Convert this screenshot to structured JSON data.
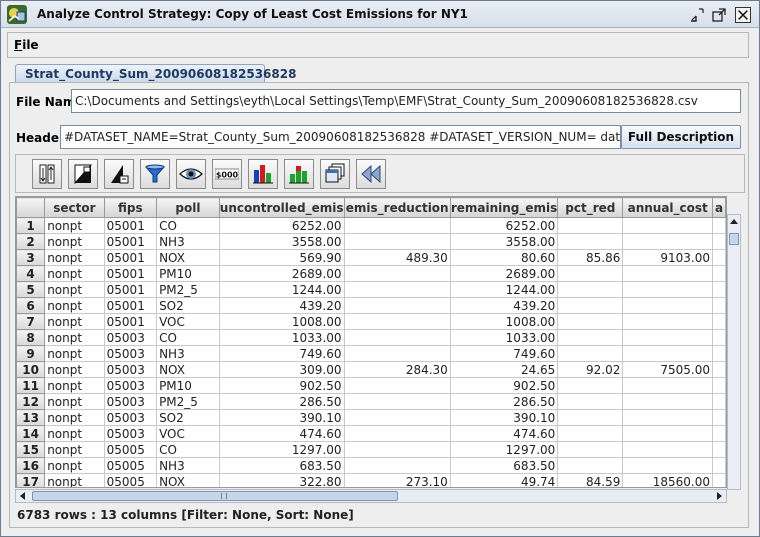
{
  "window": {
    "title": "Analyze Control Strategy: Copy of Least Cost Emissions for NY1"
  },
  "menu": {
    "file_label_u": "F",
    "file_label_rest": "ile"
  },
  "tab": {
    "label": "Strat_County_Sum_20090608182536828"
  },
  "form": {
    "file_name_label": "File Name",
    "file_name_value": "C:\\Documents and Settings\\eyth\\Local Settings\\Temp\\EMF\\Strat_County_Sum_20090608182536828.csv",
    "header_label": "Header",
    "header_value": "#DATASET_NAME=Strat_County_Sum_20090608182536828 #DATASET_VERSION_NUM= dataset.ge",
    "full_description_label": "Full Description"
  },
  "toolbar": {
    "icons": [
      "sort-columns-icon",
      "format-icon",
      "row-format-icon",
      "filter-icon",
      "view-icon",
      "money-icon",
      "bar-chart-icon",
      "stacked-chart-icon",
      "copy-windows-icon",
      "rewind-icon"
    ]
  },
  "table": {
    "columns": [
      "",
      "sector",
      "fips",
      "poll",
      "uncontrolled_emis",
      "emis_reduction",
      "remaining_emis",
      "pct_red",
      "annual_cost",
      "a"
    ],
    "rows": [
      [
        "1",
        "nonpt",
        "05001",
        "CO",
        "6252.00",
        "",
        "6252.00",
        "",
        ""
      ],
      [
        "2",
        "nonpt",
        "05001",
        "NH3",
        "3558.00",
        "",
        "3558.00",
        "",
        ""
      ],
      [
        "3",
        "nonpt",
        "05001",
        "NOX",
        "569.90",
        "489.30",
        "80.60",
        "85.86",
        "9103.00"
      ],
      [
        "4",
        "nonpt",
        "05001",
        "PM10",
        "2689.00",
        "",
        "2689.00",
        "",
        ""
      ],
      [
        "5",
        "nonpt",
        "05001",
        "PM2_5",
        "1244.00",
        "",
        "1244.00",
        "",
        ""
      ],
      [
        "6",
        "nonpt",
        "05001",
        "SO2",
        "439.20",
        "",
        "439.20",
        "",
        ""
      ],
      [
        "7",
        "nonpt",
        "05001",
        "VOC",
        "1008.00",
        "",
        "1008.00",
        "",
        ""
      ],
      [
        "8",
        "nonpt",
        "05003",
        "CO",
        "1033.00",
        "",
        "1033.00",
        "",
        ""
      ],
      [
        "9",
        "nonpt",
        "05003",
        "NH3",
        "749.60",
        "",
        "749.60",
        "",
        ""
      ],
      [
        "10",
        "nonpt",
        "05003",
        "NOX",
        "309.00",
        "284.30",
        "24.65",
        "92.02",
        "7505.00"
      ],
      [
        "11",
        "nonpt",
        "05003",
        "PM10",
        "902.50",
        "",
        "902.50",
        "",
        ""
      ],
      [
        "12",
        "nonpt",
        "05003",
        "PM2_5",
        "286.50",
        "",
        "286.50",
        "",
        ""
      ],
      [
        "13",
        "nonpt",
        "05003",
        "SO2",
        "390.10",
        "",
        "390.10",
        "",
        ""
      ],
      [
        "14",
        "nonpt",
        "05003",
        "VOC",
        "474.60",
        "",
        "474.60",
        "",
        ""
      ],
      [
        "15",
        "nonpt",
        "05005",
        "CO",
        "1297.00",
        "",
        "1297.00",
        "",
        ""
      ],
      [
        "16",
        "nonpt",
        "05005",
        "NH3",
        "683.50",
        "",
        "683.50",
        "",
        ""
      ],
      [
        "17",
        "nonpt",
        "05005",
        "NOX",
        "322.80",
        "273.10",
        "49.74",
        "84.59",
        "18560.00"
      ]
    ]
  },
  "status": "6783 rows : 13 columns [Filter: None, Sort: None]"
}
